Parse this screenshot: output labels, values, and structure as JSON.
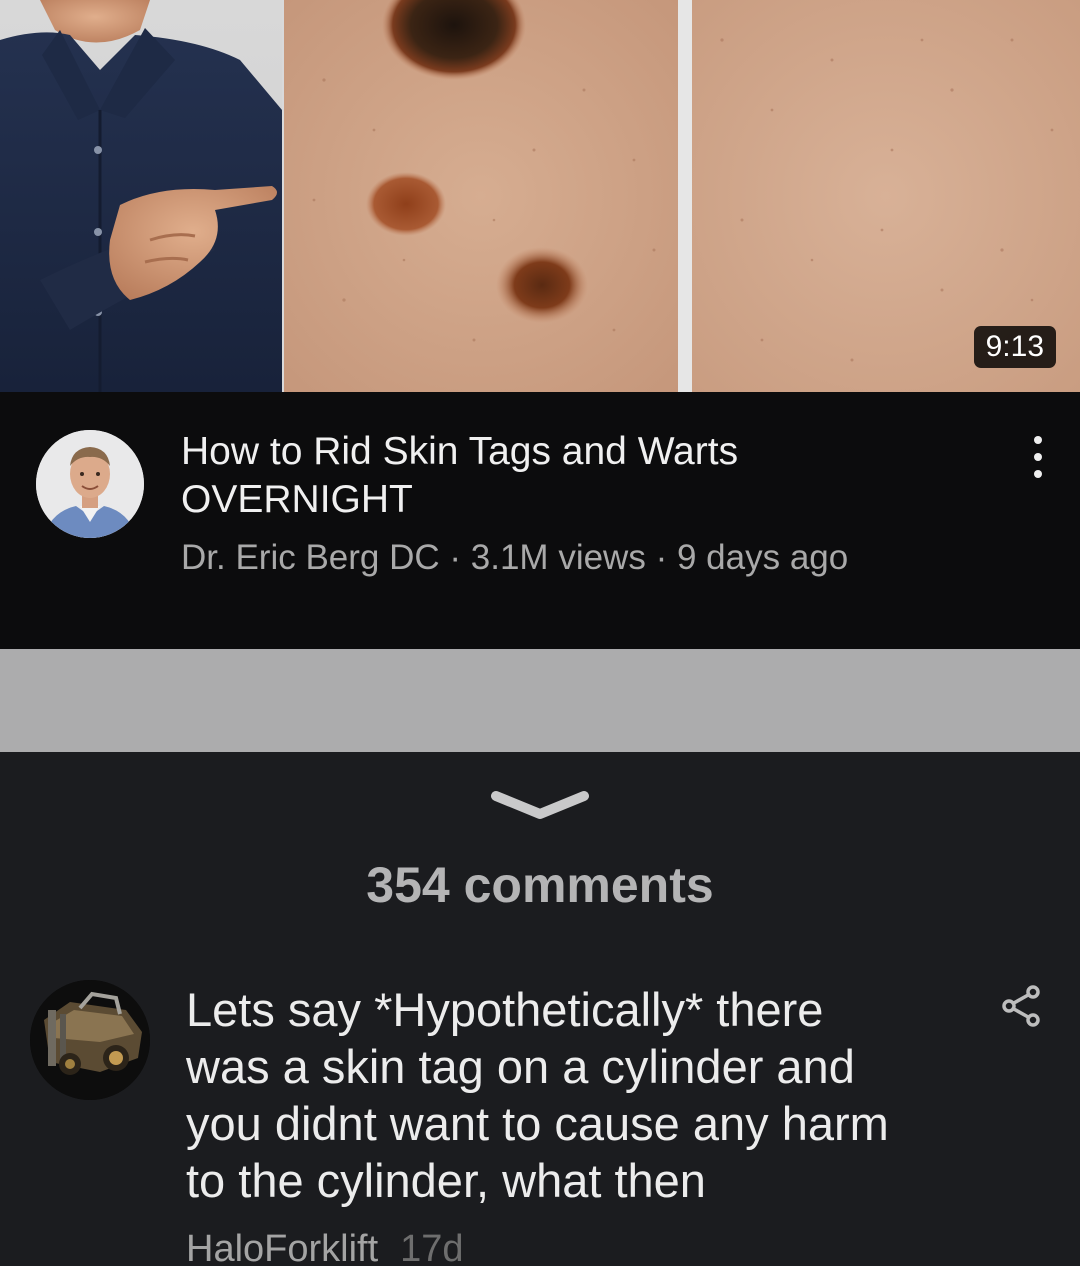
{
  "video": {
    "duration": "9:13",
    "title_line_1": "How to Rid Skin Tags and Warts",
    "title_line_2": "OVERNIGHT",
    "channel": "Dr. Eric Berg DC",
    "views": "3.1M views",
    "age": "9 days ago",
    "separator": "·"
  },
  "comments": {
    "count_label": "354 comments"
  },
  "comment": {
    "lines": [
      "Lets say *Hypothetically* there",
      "was a skin tag on a cylinder and",
      "you didnt want to cause any harm",
      "to the cylinder, what then"
    ],
    "author": "HaloForklift",
    "age": "17d"
  },
  "icons": {
    "more": "more-vertical-icon",
    "collapse": "chevron-down-icon",
    "share": "share-icon"
  },
  "colors": {
    "background": "#0c0c0d",
    "sheet": "#1b1c1f",
    "band": "#acacad",
    "title_text": "#f0f0f0",
    "meta_text": "#a9a9a9"
  }
}
